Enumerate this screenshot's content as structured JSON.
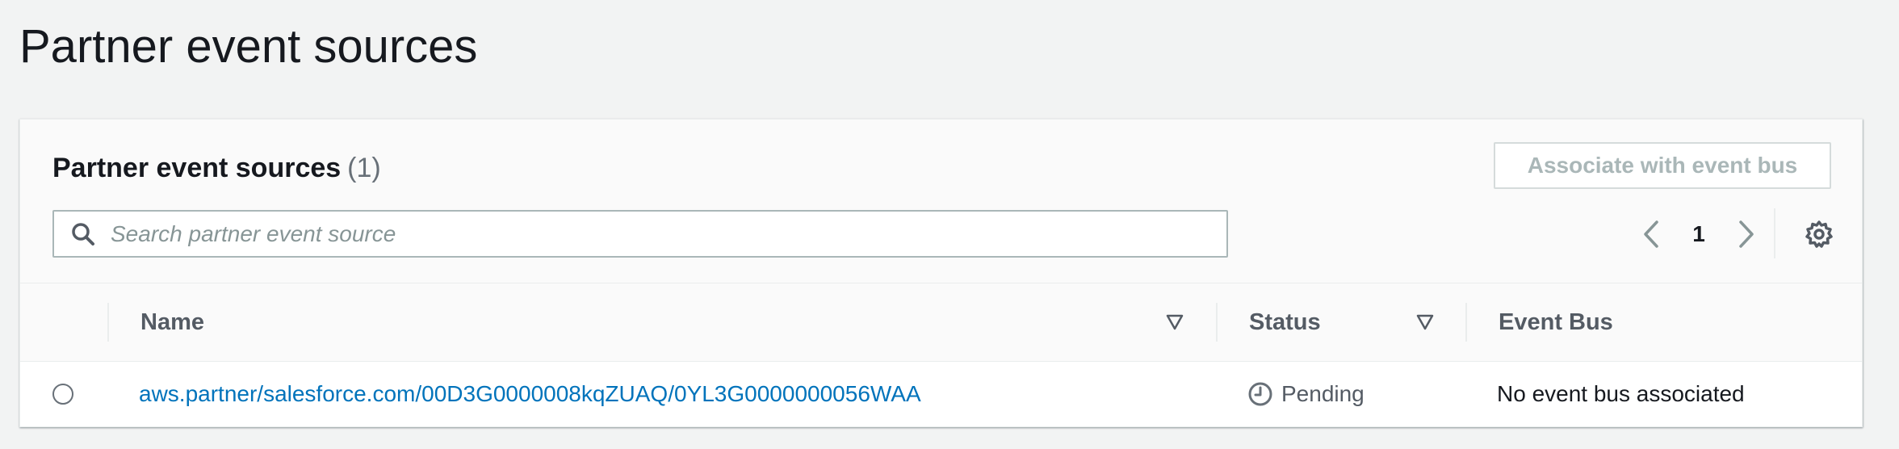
{
  "page": {
    "title": "Partner event sources"
  },
  "panel": {
    "title": "Partner event sources",
    "count": "(1)",
    "associate_button": "Associate with event bus",
    "search": {
      "placeholder": "Search partner event source",
      "value": ""
    },
    "pagination": {
      "current_page": "1"
    }
  },
  "table": {
    "columns": [
      "Name",
      "Status",
      "Event Bus"
    ],
    "rows": [
      {
        "selected": false,
        "name": "aws.partner/salesforce.com/00D3G0000008kqZUAQ/0YL3G0000000056WAA",
        "status": "Pending",
        "event_bus": "No event bus associated"
      }
    ]
  },
  "icons": {
    "search": "search-icon",
    "prev": "chevron-left-icon",
    "next": "chevron-right-icon",
    "settings": "gear-icon",
    "sort": "sort-down-icon",
    "status": "clock-icon"
  },
  "colors": {
    "link": "#0073bb",
    "page_background": "#f2f3f3",
    "disabled_text": "#aab7b8",
    "header_text": "#545b64"
  }
}
